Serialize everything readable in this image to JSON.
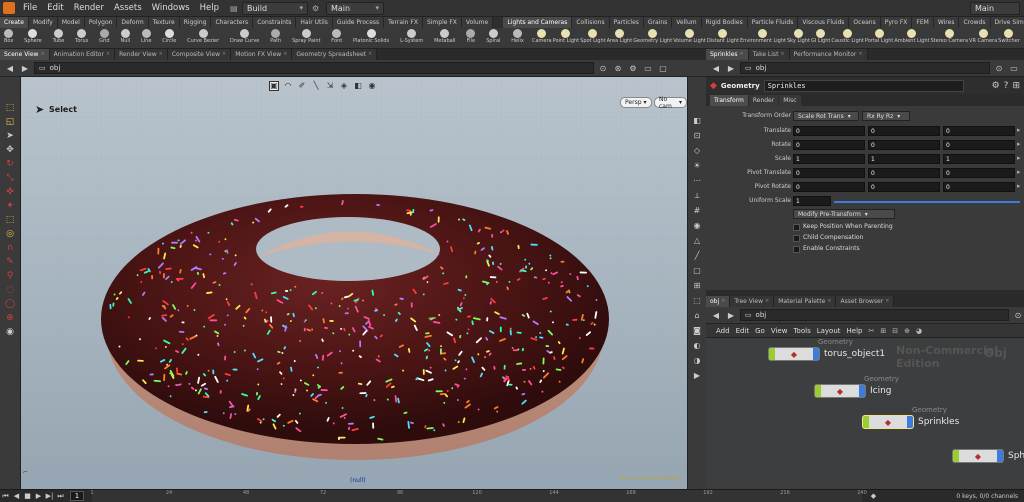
{
  "menubar": {
    "items": [
      "File",
      "Edit",
      "Render",
      "Assets",
      "Windows",
      "Help"
    ],
    "desktop": "Build",
    "context": "Main",
    "right_context": "Main"
  },
  "shelf_tabs_left": [
    "Create",
    "Modify",
    "Model",
    "Polygon",
    "Deform",
    "Texture",
    "Rigging",
    "Characters",
    "Constraints",
    "Hair Utils",
    "Guide Process",
    "Terrain FX",
    "Simple FX",
    "Volume"
  ],
  "shelf_tabs_right": [
    "Lights and Cameras",
    "Collisions",
    "Particles",
    "Grains",
    "Vellum",
    "Rigid Bodies",
    "Particle Fluids",
    "Viscous Fluids",
    "Oceans",
    "Pyro FX",
    "FEM",
    "Wires",
    "Crowds",
    "Drive Simulation"
  ],
  "tools_left": [
    "Box",
    "Sphere",
    "Tube",
    "Torus",
    "Grid",
    "Null",
    "Line",
    "Circle",
    "Curve Bezier",
    "Draw Curve",
    "Path",
    "Spray Paint",
    "Font",
    "Platonic Solids",
    "L-System",
    "Metaball",
    "File",
    "Spiral",
    "Helix"
  ],
  "tools_right": [
    "Camera",
    "Point Light",
    "Spot Light",
    "Area Light",
    "Geometry Light",
    "Volume Light",
    "Distant Light",
    "Environment Light",
    "Sky Light",
    "GI Light",
    "Caustic Light",
    "Portal Light",
    "Ambient Light",
    "Stereo Camera",
    "VR Camera",
    "Switcher"
  ],
  "viewer_tabs": [
    "Scene View",
    "Animation Editor",
    "Render View",
    "Composite View",
    "Motion FX View",
    "Geometry Spreadsheet"
  ],
  "param_tabs": [
    "Sprinkles",
    "Take List",
    "Performance Monitor"
  ],
  "viewer": {
    "path": "obj",
    "state_label": "Select",
    "persp_label": "Persp",
    "cam_label": "No cam",
    "null_label": "(null)",
    "camera_label": "Non-Commercial Edition"
  },
  "param": {
    "path": "obj",
    "node_type": "Geometry",
    "node_name": "Sprinkles",
    "subtabs": [
      "Transform",
      "Render",
      "Misc"
    ],
    "transform_order_label": "Transform Order",
    "transform_order": "Scale Rot Trans",
    "rot_order": "Rx Ry Rz",
    "rows": [
      {
        "label": "Translate",
        "values": [
          "0",
          "0",
          "0"
        ]
      },
      {
        "label": "Rotate",
        "values": [
          "0",
          "0",
          "0"
        ]
      },
      {
        "label": "Scale",
        "values": [
          "1",
          "1",
          "1"
        ]
      },
      {
        "label": "Pivot Translate",
        "values": [
          "0",
          "0",
          "0"
        ]
      },
      {
        "label": "Pivot Rotate",
        "values": [
          "0",
          "0",
          "0"
        ]
      }
    ],
    "uniform_scale_label": "Uniform Scale",
    "uniform_scale": "1",
    "modify_btn": "Modify Pre-Transform",
    "checks": [
      "Keep Position When Parenting",
      "Child Compensation",
      "Enable Constraints"
    ]
  },
  "network": {
    "tabs": [
      "obj",
      "Tree View",
      "Material Palette",
      "Asset Browser"
    ],
    "path": "obj",
    "menu": [
      "Add",
      "Edit",
      "Go",
      "View",
      "Tools",
      "Layout",
      "Help"
    ],
    "watermark": "Non-Commercial Edition",
    "watermark2": "Obj",
    "nodes": [
      {
        "type": "Geometry",
        "name": "torus_object1"
      },
      {
        "type": "Geometry",
        "name": "Icing"
      },
      {
        "type": "Geometry",
        "name": "Sprinkles"
      },
      {
        "type": "",
        "name": "Sph"
      }
    ]
  },
  "timeline": {
    "frame": "1",
    "ticks": [
      "1",
      "24",
      "48",
      "72",
      "96",
      "120",
      "144",
      "168",
      "192",
      "216",
      "240"
    ],
    "keys_label": "0 keys, 0/0 channels"
  },
  "colors": {
    "accent": "#e6c24a",
    "node_left": "#9acd32",
    "node_right": "#3b7dd8",
    "donut_glaze": "#4a1414",
    "donut_dough": "#c9a08a"
  }
}
